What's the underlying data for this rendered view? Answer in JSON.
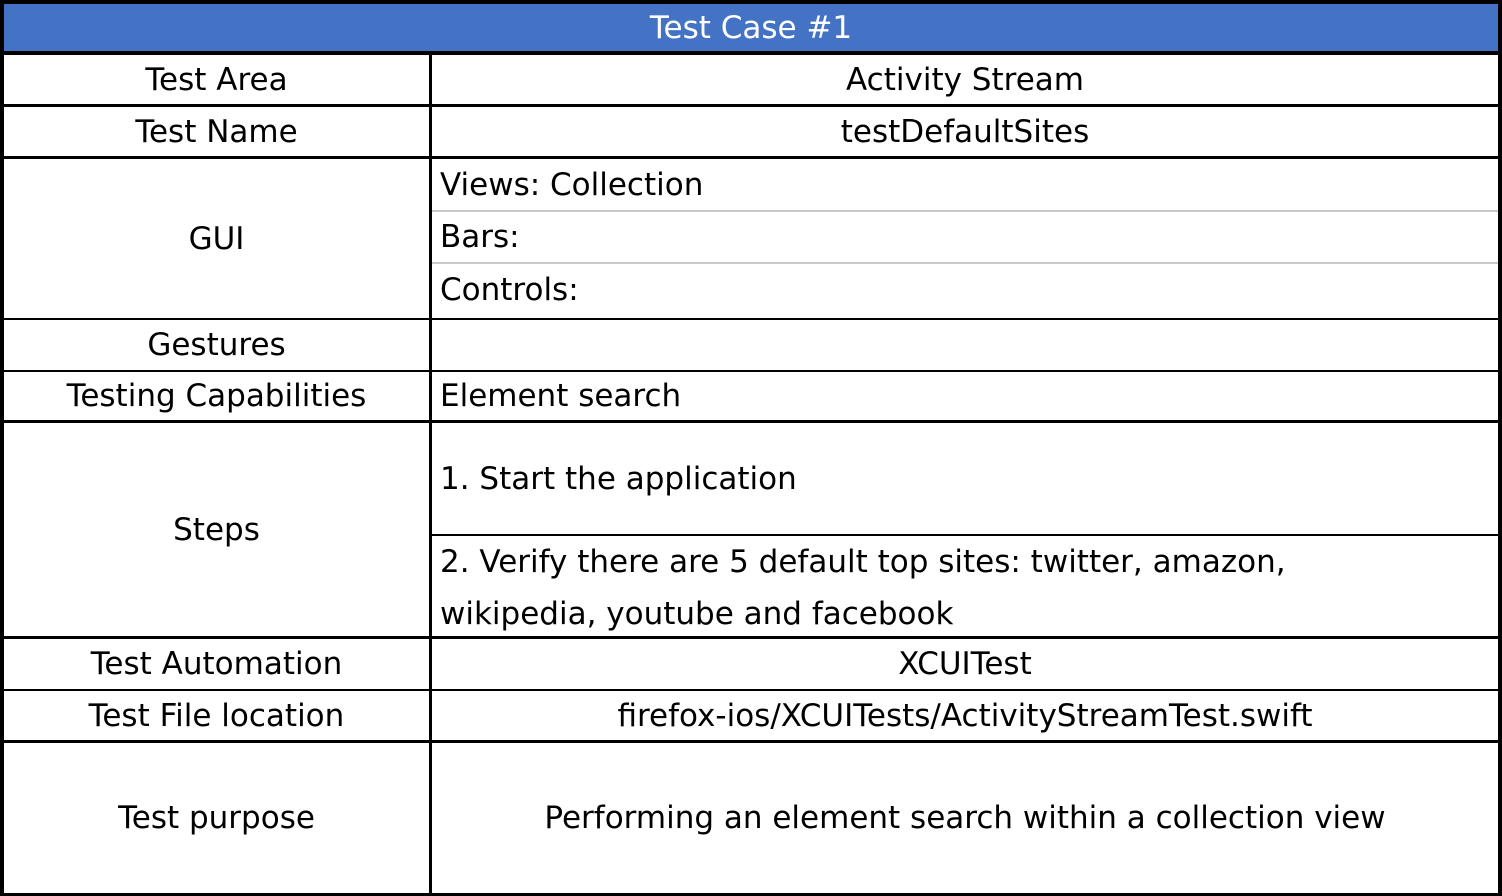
{
  "title": "Test Case #1",
  "colors": {
    "header_bg": "#4472c4",
    "header_text": "#ffffff",
    "grid": "#000000",
    "subgrid": "#c9c9c9"
  },
  "rows": {
    "test_area": {
      "label": "Test Area",
      "value": "Activity Stream"
    },
    "test_name": {
      "label": "Test Name",
      "value": "testDefaultSites"
    },
    "gui": {
      "label": "GUI",
      "views": "Views: Collection",
      "bars": "Bars:",
      "controls": "Controls:"
    },
    "gestures": {
      "label": "Gestures",
      "value": ""
    },
    "testing_capabilities": {
      "label": "Testing Capabilities",
      "value": "Element search"
    },
    "steps": {
      "label": "Steps",
      "step1": "1. Start the application",
      "step2": "2. Verify there are 5 default top sites: twitter, amazon, wikipedia, youtube and facebook"
    },
    "test_automation": {
      "label": "Test Automation",
      "value": "XCUITest"
    },
    "test_file_location": {
      "label": "Test File location",
      "value": "firefox-ios/XCUITests/ActivityStreamTest.swift"
    },
    "test_purpose": {
      "label": "Test purpose",
      "value": "Performing an element search within a collection view"
    }
  }
}
